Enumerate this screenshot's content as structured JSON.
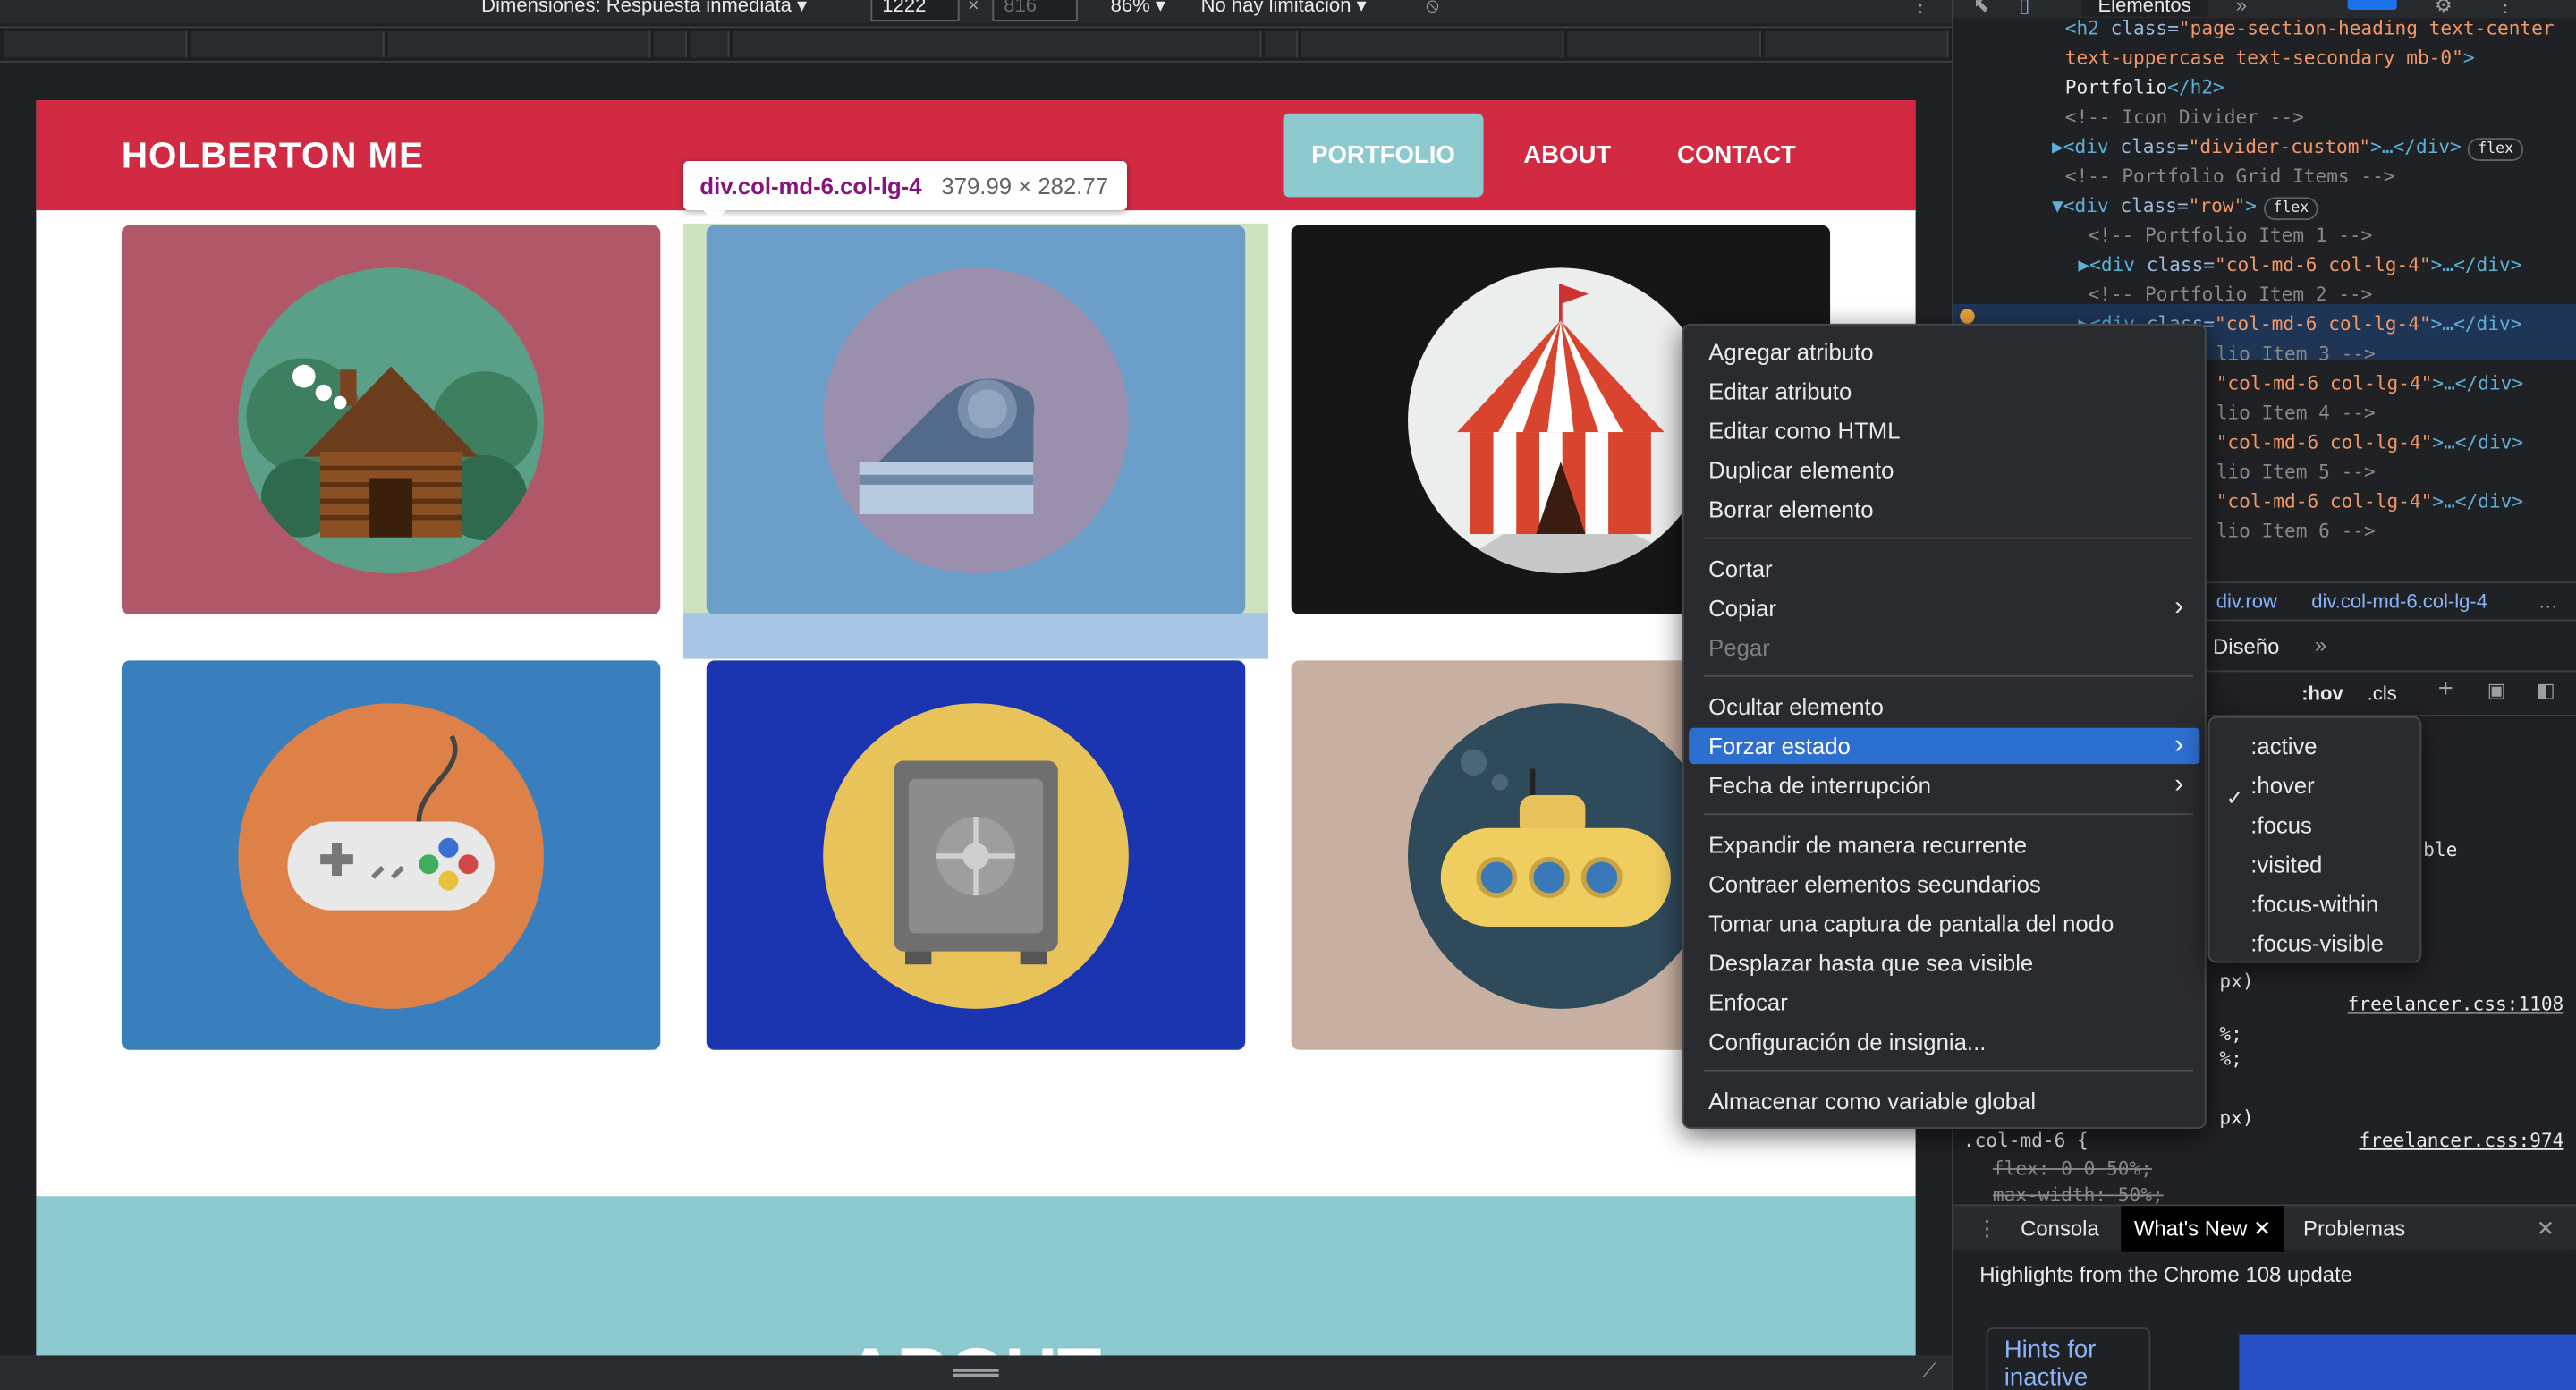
{
  "device_toolbar": {
    "dimensions_label": "Dimensiones: Respuesta inmediata ▾",
    "width": "1222",
    "height": "816",
    "times": "×",
    "zoom": "86% ▾",
    "throttle": "No hay limitación ▾"
  },
  "site": {
    "brand": "HOLBERTON ME",
    "nav": [
      "PORTFOLIO",
      "ABOUT",
      "CONTACT"
    ],
    "section_title": "ABOUT",
    "tile_colors": [
      "#b05868",
      "#6b9fca",
      "#161616",
      "#3a7fbd",
      "#1b34b0",
      "#c7b0a2"
    ]
  },
  "inspect_tooltip": {
    "tag": "div.col-md-6.col-lg-4",
    "size": "379.99 × 282.77"
  },
  "devtools": {
    "tab": "Elementos",
    "code_lines": [
      {
        "parts": [
          [
            "c-tag",
            "<h2 "
          ],
          [
            "c-attr",
            "class="
          ],
          [
            "c-val",
            "\"page-section-heading text-center"
          ]
        ]
      },
      {
        "parts": [
          [
            "c-val",
            "text-uppercase text-secondary mb-0\""
          ],
          [
            "c-tag",
            ">"
          ]
        ]
      },
      {
        "parts": [
          [
            "c-txt",
            "Portfolio"
          ],
          [
            "c-tag",
            "</h2>"
          ]
        ]
      },
      {
        "parts": [
          [
            "c-com",
            "<!-- Icon Divider -->"
          ]
        ]
      },
      {
        "parts": [
          [
            "c-tag",
            "▶<div "
          ],
          [
            "c-attr",
            "class="
          ],
          [
            "c-val",
            "\"divider-custom\""
          ],
          [
            "c-tag",
            ">…</div>"
          ]
        ],
        "badge": "flex"
      },
      {
        "parts": [
          [
            "c-com",
            "<!-- Portfolio Grid Items -->"
          ]
        ]
      },
      {
        "parts": [
          [
            "c-tag",
            "▼<div "
          ],
          [
            "c-attr",
            "class="
          ],
          [
            "c-val",
            "\"row\""
          ],
          [
            "c-tag",
            ">"
          ]
        ],
        "badge": "flex"
      },
      {
        "parts": [
          [
            "c-com",
            "<!-- Portfolio Item 1 -->"
          ]
        ]
      },
      {
        "parts": [
          [
            "c-tag",
            "▶<div "
          ],
          [
            "c-attr",
            "class="
          ],
          [
            "c-val",
            "\"col-md-6 col-lg-4\""
          ],
          [
            "c-tag",
            ">…</div>"
          ]
        ]
      },
      {
        "parts": [
          [
            "c-com",
            "<!-- Portfolio Item 2 -->"
          ]
        ]
      },
      {
        "parts": [
          [
            "c-tag",
            "▶<div "
          ],
          [
            "c-attr",
            "class="
          ],
          [
            "c-val",
            "\"col-md-6 col-lg-4\""
          ],
          [
            "c-tag",
            ">…</div>"
          ]
        ]
      },
      {
        "parts": [
          [
            "c-com",
            "lio Item 3 -->"
          ]
        ]
      },
      {
        "parts": [
          [
            "c-val",
            "\"col-md-6 col-lg-4\""
          ],
          [
            "c-tag",
            ">…</div>"
          ]
        ]
      },
      {
        "parts": [
          [
            "c-com",
            "lio Item 4 -->"
          ]
        ]
      },
      {
        "parts": [
          [
            "c-val",
            "\"col-md-6 col-lg-4\""
          ],
          [
            "c-tag",
            ">…</div>"
          ]
        ]
      },
      {
        "parts": [
          [
            "c-com",
            "lio Item 5 -->"
          ]
        ]
      },
      {
        "parts": [
          [
            "c-val",
            "\"col-md-6 col-lg-4\""
          ],
          [
            "c-tag",
            ">…</div>"
          ]
        ]
      },
      {
        "parts": [
          [
            "c-com",
            "lio Item 6 -->"
          ]
        ]
      }
    ],
    "breadcrumbs": [
      "div.row",
      "div.col-md-6.col-lg-4",
      "…"
    ],
    "styles_tab": "Diseño",
    "hov": ":hov",
    "cls": ".cls",
    "style_snippets": {
      "ble": "ble",
      "px1": "px)",
      "link1": "freelancer.css:1108",
      "pct1": "%;",
      "pct2": "%;",
      "px2": "px)",
      "selector": ".col-md-6 {",
      "link2": "freelancer.css:974",
      "flex": "flex: 0 0 50%;",
      "maxw": "max-width: 50%;"
    },
    "drawer_tabs": [
      "Consola",
      "What's New",
      "Problemas"
    ],
    "whats_new_heading": "Highlights from the Chrome 108 update",
    "hints_card": "Hints for inactive"
  },
  "context_menu": {
    "items": [
      {
        "label": "Agregar atributo"
      },
      {
        "label": "Editar atributo"
      },
      {
        "label": "Editar como HTML"
      },
      {
        "label": "Duplicar elemento"
      },
      {
        "label": "Borrar elemento"
      },
      {
        "label": "Cortar"
      },
      {
        "label": "Copiar",
        "submenu": true
      },
      {
        "label": "Pegar",
        "disabled": true
      },
      {
        "label": "Ocultar elemento"
      },
      {
        "label": "Forzar estado",
        "submenu": true,
        "highlighted": true
      },
      {
        "label": "Fecha de interrupción",
        "submenu": true
      },
      {
        "label": "Expandir de manera recurrente"
      },
      {
        "label": "Contraer elementos secundarios"
      },
      {
        "label": "Tomar una captura de pantalla del nodo"
      },
      {
        "label": "Desplazar hasta que sea visible"
      },
      {
        "label": "Enfocar"
      },
      {
        "label": "Configuración de insignia..."
      },
      {
        "label": "Almacenar como variable global"
      }
    ],
    "submenu_items": [
      ":active",
      ":hover",
      ":focus",
      ":visited",
      ":focus-within",
      ":focus-visible"
    ],
    "checked_state": ":hover"
  }
}
